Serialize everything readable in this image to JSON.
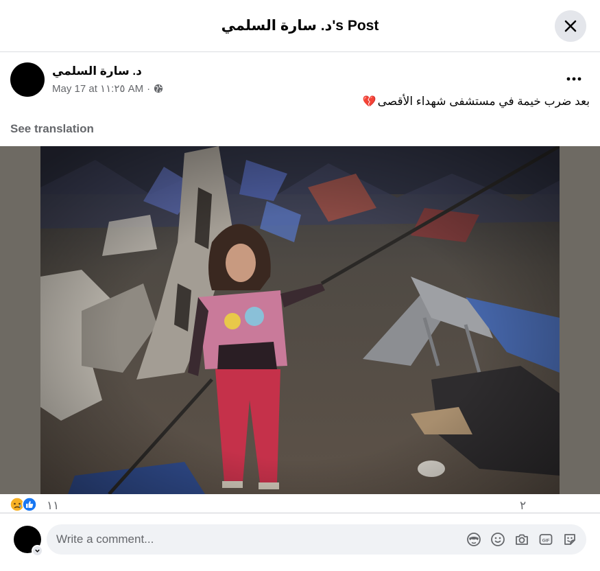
{
  "modal": {
    "title": "د. سارة السلمي's Post"
  },
  "post": {
    "author": "د. سارة السلمي",
    "timestamp": "May 17 at ١١:٢٥ AM",
    "separator": "·",
    "audience_icon": "globe-icon",
    "text": "بعد ضرب خيمة في مستشفى شهداء الأقصى",
    "text_emoji": "💔",
    "see_translation": "See translation",
    "photo_description_icon": "photo"
  },
  "reactions": {
    "icons": [
      "sad-reaction-icon",
      "like-reaction-icon"
    ],
    "count": "١١",
    "comments": "٢"
  },
  "composer": {
    "placeholder": "Write a comment...",
    "tools": [
      "avatar-sticker-icon",
      "emoji-icon",
      "camera-icon",
      "gif-icon",
      "sticker-icon"
    ]
  },
  "colors": {
    "accent": "#1877f2",
    "secondary_text": "#65676b",
    "input_bg": "#f0f2f5",
    "photo_letterbox": "#6e6a63"
  }
}
